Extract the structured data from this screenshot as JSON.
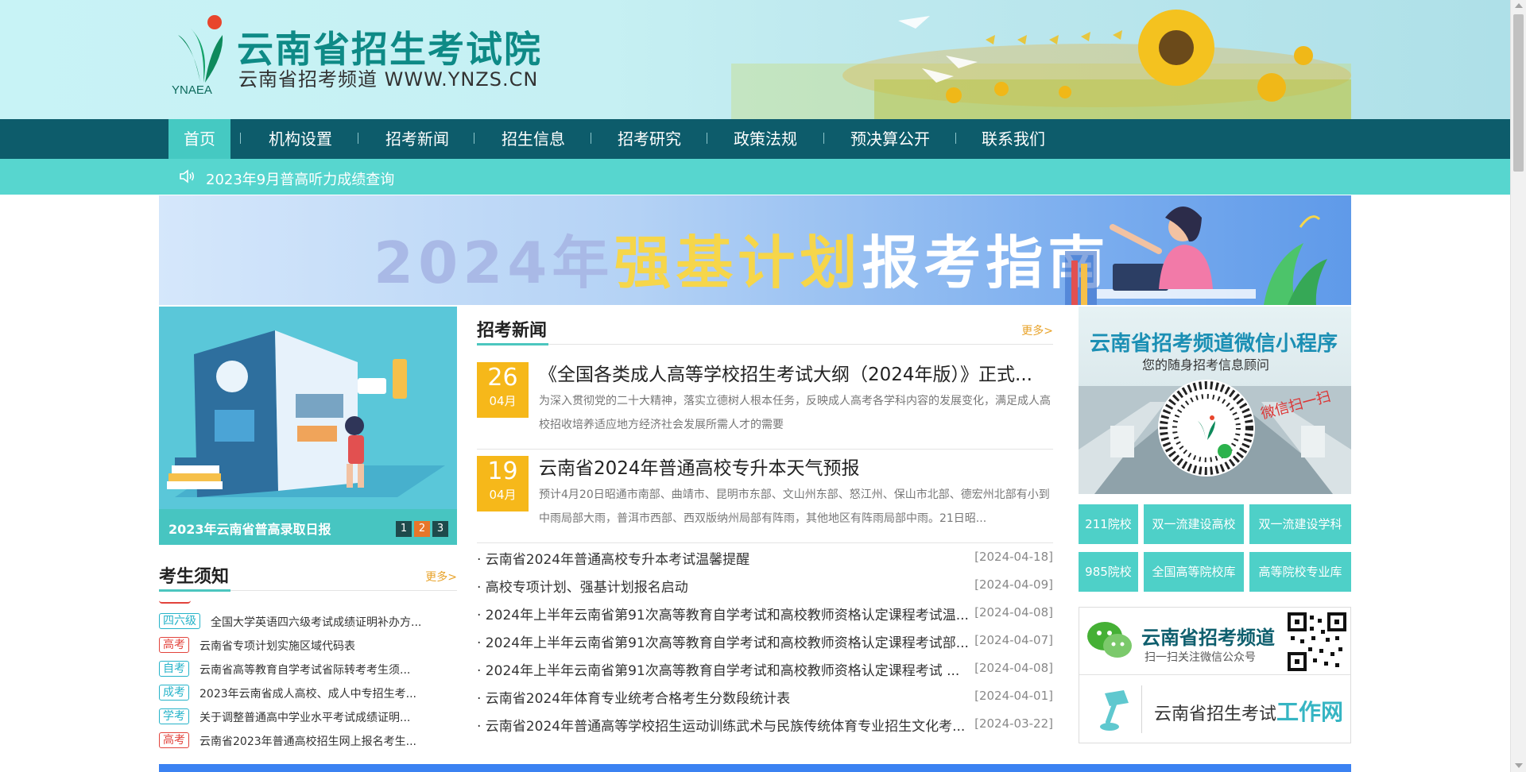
{
  "header": {
    "logo_text": "YNAEA",
    "title": "云南省招生考试院",
    "subtitle": "云南省招考频道 WWW.YNZS.CN"
  },
  "nav": {
    "items": [
      {
        "label": "首页",
        "active": true
      },
      {
        "label": "机构设置"
      },
      {
        "label": "招考新闻"
      },
      {
        "label": "招生信息"
      },
      {
        "label": "招考研究"
      },
      {
        "label": "政策法规"
      },
      {
        "label": "预决算公开"
      },
      {
        "label": "联系我们"
      }
    ]
  },
  "notice": {
    "text": "2023年9月普高听力成绩查询"
  },
  "banner": {
    "part1": "2024年",
    "part2": "强基计划",
    "part3": "报考指南"
  },
  "slider": {
    "caption": "2023年云南省普高录取日报",
    "dots": [
      "1",
      "2",
      "3"
    ],
    "active_dot": 2
  },
  "tips": {
    "title": "考生须知",
    "more": "更多>",
    "items": [
      {
        "tag": "四六级",
        "tag_color": "blue",
        "text": "全国大学英语四六级考试成绩证明补办方..."
      },
      {
        "tag": "高考",
        "tag_color": "red",
        "text": "云南省专项计划实施区域代码表"
      },
      {
        "tag": "自考",
        "tag_color": "blue",
        "text": "云南省高等教育自学考试省际转考考生须..."
      },
      {
        "tag": "成考",
        "tag_color": "blue",
        "text": "2023年云南省成人高校、成人中专招生考..."
      },
      {
        "tag": "学考",
        "tag_color": "blue",
        "text": "关于调整普通高中学业水平考试成绩证明..."
      },
      {
        "tag": "高考",
        "tag_color": "red",
        "text": "云南省2023年普通高校招生网上报名考生..."
      }
    ]
  },
  "news": {
    "title": "招考新闻",
    "more": "更多>",
    "featured": [
      {
        "day": "26",
        "month": "04月",
        "title": "《全国各类成人高等学校招生考试大纲（2024年版）》正式...",
        "desc": "为深入贯彻党的二十大精神，落实立德树人根本任务，反映成人高考各学科内容的发展变化，满足成人高校招收培养适应地方经济社会发展所需人才的需要"
      },
      {
        "day": "19",
        "month": "04月",
        "title": "云南省2024年普通高校专升本天气预报",
        "desc": "预计4月20日昭通市南部、曲靖市、昆明市东部、文山州东部、怒江州、保山市北部、德宏州北部有小到中雨局部大雨，普洱市西部、西双版纳州局部有阵雨，其他地区有阵雨局部中雨。21日昭..."
      }
    ],
    "list": [
      {
        "title": "· 云南省2024年普通高校专升本考试温馨提醒",
        "date": "[2024-04-18]"
      },
      {
        "title": "· 高校专项计划、强基计划报名启动",
        "date": "[2024-04-09]"
      },
      {
        "title": "· 2024年上半年云南省第91次高等教育自学考试和高校教师资格认定课程考试温...",
        "date": "[2024-04-08]"
      },
      {
        "title": "· 2024年上半年云南省第91次高等教育自学考试和高校教师资格认定课程考试部...",
        "date": "[2024-04-07]"
      },
      {
        "title": "· 2024年上半年云南省第91次高等教育自学考试和高校教师资格认定课程考试 ...",
        "date": "[2024-04-08]"
      },
      {
        "title": "· 云南省2024年体育专业统考合格考生分数段统计表",
        "date": "[2024-04-01]"
      },
      {
        "title": "· 云南省2024年普通高等学校招生运动训练武术与民族传统体育专业招生文化考...",
        "date": "[2024-03-22]"
      }
    ]
  },
  "mini_program": {
    "title": "云南省招考频道微信小程序",
    "subtitle": "您的随身招考信息顾问",
    "scan": "微信扫一扫"
  },
  "quick_links": [
    "211院校",
    "双一流建设高校",
    "双一流建设学科",
    "985院校",
    "全国高等院校库",
    "高等院校专业库"
  ],
  "wechat": {
    "name": "云南省招考频道",
    "scan": "扫一扫关注微信公众号",
    "work_prefix": "云南省招生考试",
    "work_highlight": "工作网"
  }
}
